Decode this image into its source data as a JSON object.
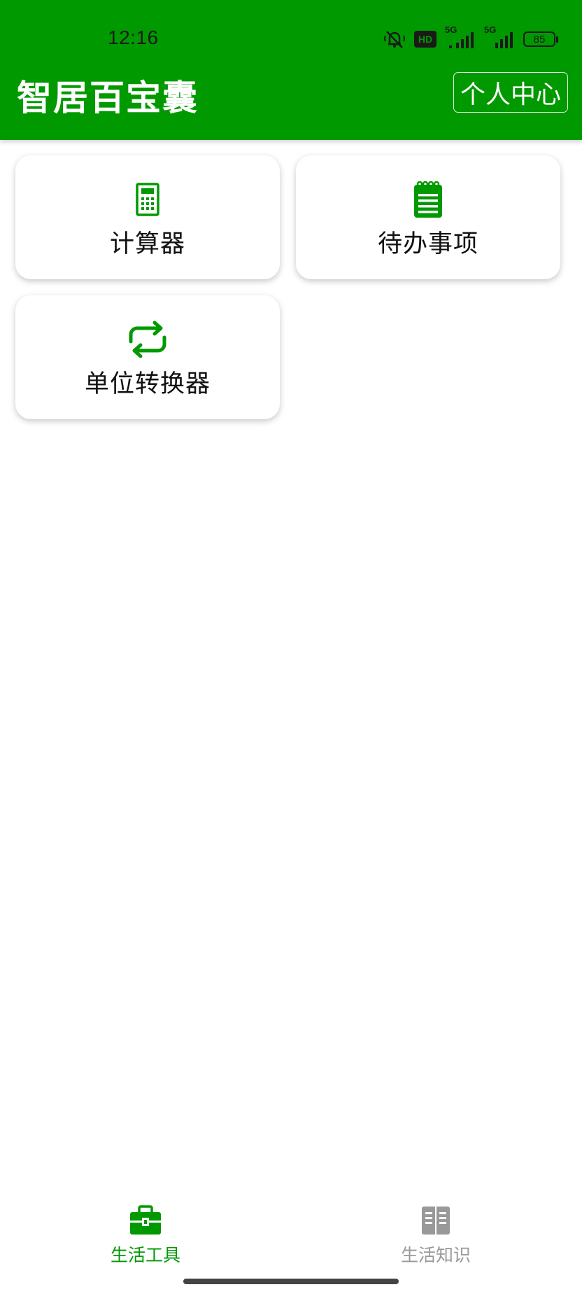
{
  "status_bar": {
    "time": "12:16",
    "battery": "85",
    "network_1": "5G",
    "network_2": "5G",
    "hd_label": "HD"
  },
  "header": {
    "title": "智居百宝囊",
    "profile_button": "个人中心"
  },
  "tools": [
    {
      "label": "计算器",
      "icon": "calculator-icon"
    },
    {
      "label": "待办事项",
      "icon": "notepad-icon"
    },
    {
      "label": "单位转换器",
      "icon": "repeat-arrows-icon"
    }
  ],
  "bottom_nav": {
    "items": [
      {
        "label": "生活工具",
        "icon": "toolbox-icon",
        "active": true
      },
      {
        "label": "生活知识",
        "icon": "book-icon",
        "active": false
      }
    ]
  },
  "colors": {
    "primary": "#009900",
    "inactive": "#999999",
    "background": "#ffffff"
  }
}
